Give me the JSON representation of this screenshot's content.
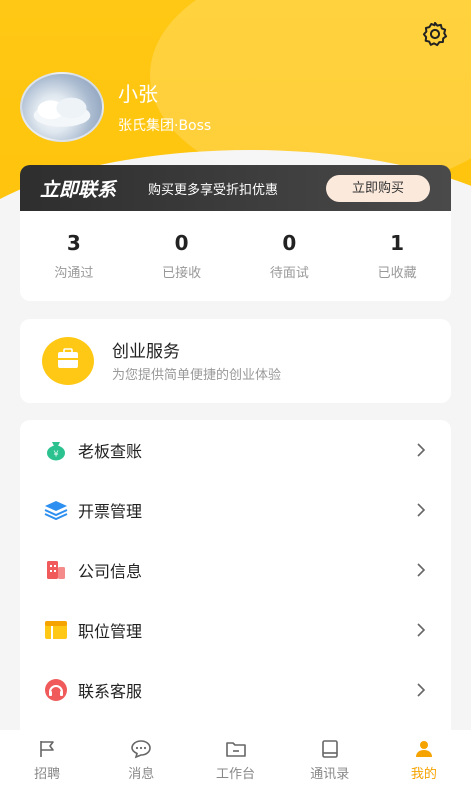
{
  "profile": {
    "name": "小张",
    "company": "张氏集团·Boss"
  },
  "promo": {
    "title": "立即联系",
    "subtitle": "购买更多享受折扣优惠",
    "button": "立即购买"
  },
  "stats": [
    {
      "value": "3",
      "label": "沟通过"
    },
    {
      "value": "0",
      "label": "已接收"
    },
    {
      "value": "0",
      "label": "待面试"
    },
    {
      "value": "1",
      "label": "已收藏"
    }
  ],
  "service": {
    "title": "创业服务",
    "description": "为您提供简单便捷的创业体验"
  },
  "menu": [
    {
      "label": "老板查账",
      "icon": "money-bag-icon"
    },
    {
      "label": "开票管理",
      "icon": "layers-icon"
    },
    {
      "label": "公司信息",
      "icon": "building-icon"
    },
    {
      "label": "职位管理",
      "icon": "table-icon"
    },
    {
      "label": "联系客服",
      "icon": "headset-icon"
    }
  ],
  "tabs": [
    {
      "label": "招聘",
      "icon": "flag-icon",
      "active": false
    },
    {
      "label": "消息",
      "icon": "chat-icon",
      "active": false
    },
    {
      "label": "工作台",
      "icon": "folder-icon",
      "active": false
    },
    {
      "label": "通讯录",
      "icon": "book-icon",
      "active": false
    },
    {
      "label": "我的",
      "icon": "person-icon",
      "active": true
    }
  ],
  "colors": {
    "brand_yellow": "#ffc814",
    "active_tab": "#f5a300",
    "promo_dark": "#2e2e2e"
  }
}
